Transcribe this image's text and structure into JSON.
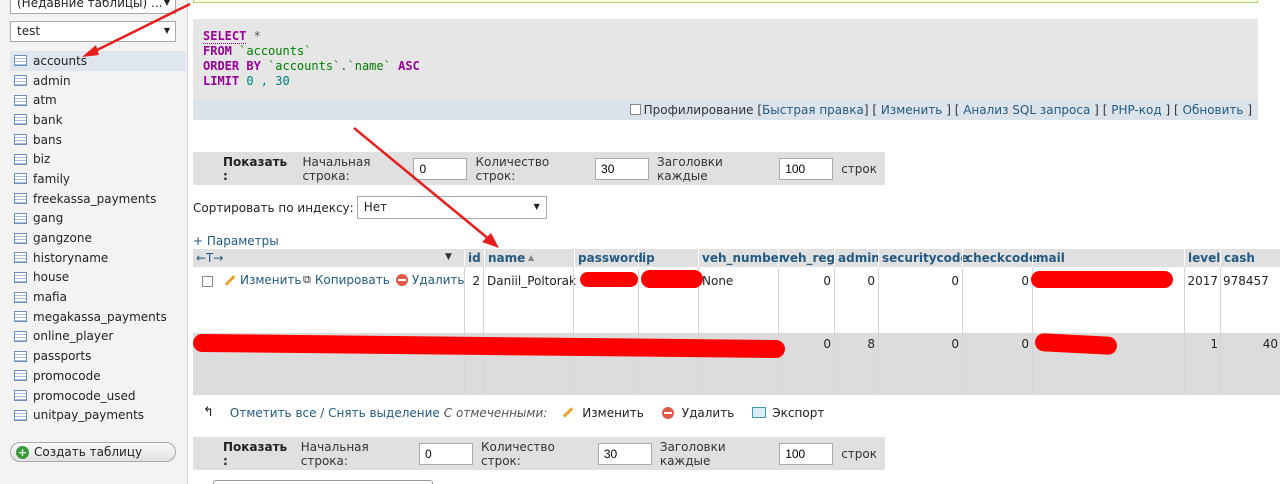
{
  "sidebar": {
    "recent_select": "(Недавние таблицы) ...",
    "db_select": "test",
    "tables": [
      {
        "label": "accounts"
      },
      {
        "label": "admin"
      },
      {
        "label": "atm"
      },
      {
        "label": "bank"
      },
      {
        "label": "bans"
      },
      {
        "label": "biz"
      },
      {
        "label": "family"
      },
      {
        "label": "freekassa_payments"
      },
      {
        "label": "gang"
      },
      {
        "label": "gangzone"
      },
      {
        "label": "historyname"
      },
      {
        "label": "house"
      },
      {
        "label": "mafia"
      },
      {
        "label": "megakassa_payments"
      },
      {
        "label": "online_player"
      },
      {
        "label": "passports"
      },
      {
        "label": "promocode"
      },
      {
        "label": "promocode_used"
      },
      {
        "label": "unitpay_payments"
      }
    ],
    "create_table": "Создать таблицу"
  },
  "sql": {
    "select_kw": "SELECT",
    "star": "*",
    "from_kw": "FROM",
    "table": "`accounts`",
    "orderby_kw": "ORDER BY",
    "order_col": "`accounts`.`name`",
    "asc_kw": "ASC",
    "limit_kw": "LIMIT",
    "limit_vals": "0 , 30"
  },
  "sql_links": {
    "profiling": "Профилирование",
    "quick_edit": "Быстрая правка",
    "edit": "Изменить",
    "analyze": "Анализ SQL запроса",
    "php": "PHP-код",
    "refresh": "Обновить",
    "open_b": "[",
    "close_b": "]"
  },
  "nav": {
    "show": "Показать :",
    "start_row": "Начальная строка:",
    "start_val": "0",
    "rows_count": "Количество строк:",
    "rows_val": "30",
    "headers_every": "Заголовки каждые",
    "headers_val": "100",
    "rows_suffix": "строк"
  },
  "sort": {
    "label": "Сортировать по индексу:",
    "value": "Нет"
  },
  "params": "+ Параметры",
  "table": {
    "move_arrows": "←T→",
    "headers": [
      "id",
      "name",
      "password",
      "ip",
      "veh_number",
      "veh_reg",
      "admin",
      "securitycode",
      "checkcode",
      "mail",
      "level",
      "cash"
    ],
    "sort_mark": "▲",
    "row_actions": {
      "edit": "Изменить",
      "copy": "Копировать",
      "delete": "Удалить"
    },
    "row1": {
      "id": "2",
      "name": "Daniil_Poltorak",
      "veh_number": "None",
      "veh_reg": "0",
      "admin": "0",
      "securitycode": "0",
      "checkcode": "0",
      "level": "2017",
      "cash": "978457"
    },
    "row2": {
      "veh_reg": "0",
      "admin": "8",
      "securitycode": "0",
      "checkcode": "0",
      "level": "1",
      "cash": "40"
    }
  },
  "bottom": {
    "select_all": "Отметить все / Снять выделение",
    "with_selected": "С отмеченными:",
    "edit": "Изменить",
    "delete": "Удалить",
    "export": "Экспорт"
  },
  "colors": {
    "link": "#235a81",
    "keyword": "#990099",
    "string": "#008000",
    "redaction": "#ff0000"
  }
}
